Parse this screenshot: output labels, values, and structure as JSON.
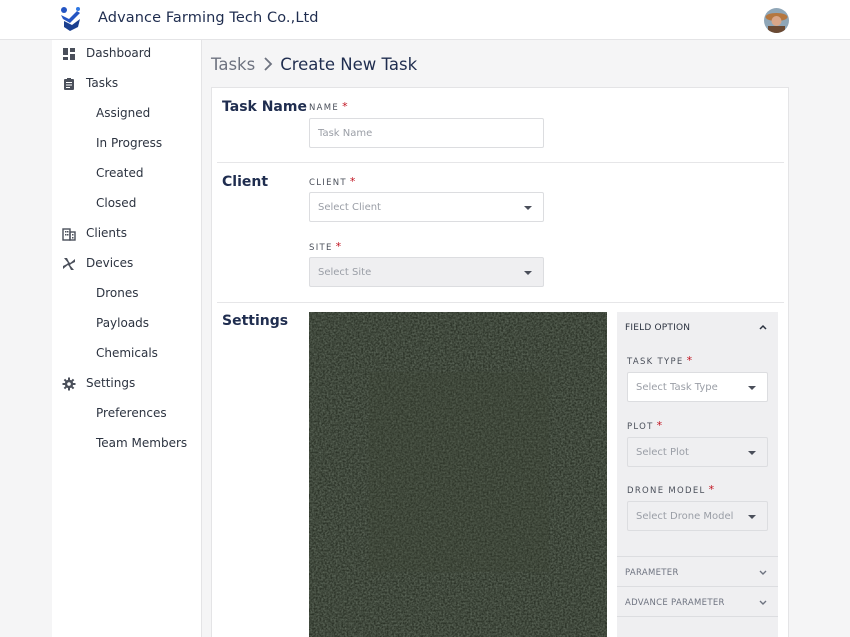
{
  "header": {
    "title": "Advance Farming Tech Co.,Ltd",
    "logo_icon": "company-logo",
    "avatar_icon": "user-avatar"
  },
  "sidebar": {
    "items": [
      {
        "label": "Dashboard",
        "icon": "dashboard-icon"
      },
      {
        "label": "Tasks",
        "icon": "clipboard-icon"
      },
      {
        "label": "Assigned"
      },
      {
        "label": "In Progress"
      },
      {
        "label": "Created"
      },
      {
        "label": "Closed"
      },
      {
        "label": "Clients",
        "icon": "building-icon"
      },
      {
        "label": "Devices",
        "icon": "drone-icon"
      },
      {
        "label": "Drones"
      },
      {
        "label": "Payloads"
      },
      {
        "label": "Chemicals"
      },
      {
        "label": "Settings",
        "icon": "gear-icon"
      },
      {
        "label": "Preferences"
      },
      {
        "label": "Team Members"
      }
    ]
  },
  "breadcrumb": {
    "root": "Tasks",
    "current": "Create New Task"
  },
  "form": {
    "task_name": {
      "section": "Task Name",
      "label": "NAME",
      "required": "*",
      "placeholder": "Task Name"
    },
    "client": {
      "section": "Client",
      "client_label": "CLIENT",
      "client_placeholder": "Select Client",
      "site_label": "SITE",
      "site_placeholder": "Select Site",
      "required": "*"
    },
    "settings": {
      "section": "Settings",
      "panel": {
        "title": "FIELD OPTION",
        "task_type_label": "TASK TYPE",
        "task_type_placeholder": "Select Task Type",
        "plot_label": "PLOT",
        "plot_placeholder": "Select Plot",
        "drone_model_label": "DRONE MODEL",
        "drone_model_placeholder": "Select Drone Model",
        "required": "*",
        "parameter": "PARAMETER",
        "advance_parameter": "ADVANCE PARAMETER"
      }
    }
  },
  "colors": {
    "brand": "#1f2d4f",
    "required": "#c1121f",
    "map": "#2b3327"
  }
}
